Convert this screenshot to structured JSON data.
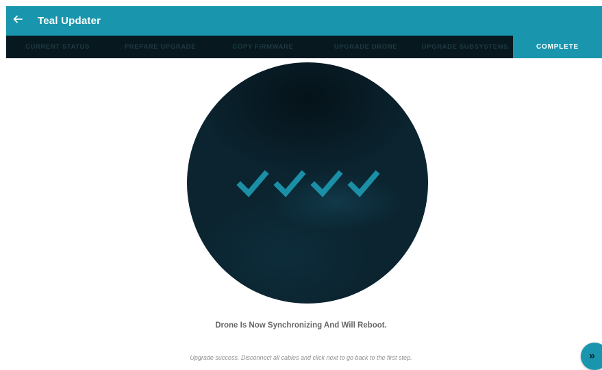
{
  "header": {
    "title": "Teal Updater",
    "back_icon": "arrow-left-icon"
  },
  "tabs": [
    {
      "label": "CURRENT STATUS",
      "active": false
    },
    {
      "label": "PREPARE UPGRADE",
      "active": false
    },
    {
      "label": "COPY FIRMWARE",
      "active": false
    },
    {
      "label": "UPGRADE DRONE",
      "active": false
    },
    {
      "label": "UPGRADE SUBSYSTEMS",
      "active": false
    },
    {
      "label": "COMPLETE",
      "active": true
    }
  ],
  "main": {
    "checkmark_count": 4,
    "status_message": "Drone Is Now Synchronizing And Will Reboot.",
    "hint_message": "Upgrade success. Disconnect all cables and click next to go back to the first step."
  },
  "next_button": {
    "label": "»",
    "icon": "double-chevron-right-icon"
  },
  "colors": {
    "accent": "#1996ad",
    "dark": "#07191f",
    "circle": "#0b2430"
  }
}
